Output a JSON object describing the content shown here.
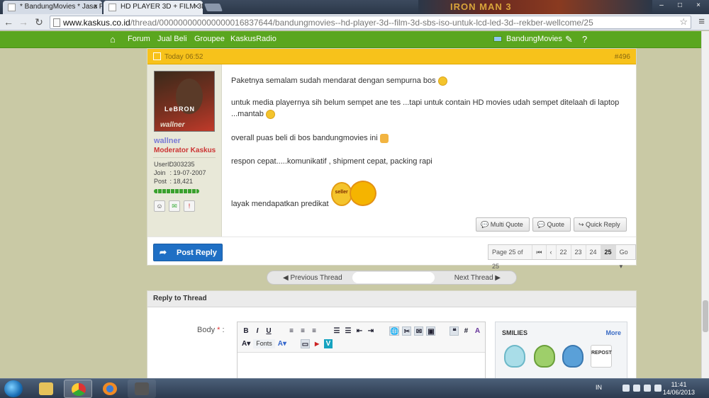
{
  "browser": {
    "tabs": [
      {
        "label": "* BandungMovies * Jasa P",
        "close": "×"
      },
      {
        "label": "HD PLAYER 3D + FILM 3D",
        "close": "×"
      }
    ],
    "banner_text": "IRON MAN 3",
    "window_buttons": [
      "–",
      "□",
      "×"
    ],
    "url_domain": "www.kaskus.co.id",
    "url_path": "/thread/000000000000000016837644/bandungmovies--hd-player-3d--film-3d-sbs-iso-untuk-lcd-led-3d--rekber-wellcome/25"
  },
  "site_nav": {
    "items": [
      "Forum",
      "Jual Beli",
      "Groupee",
      "KaskusRadio"
    ],
    "user": "BandungMovies"
  },
  "post": {
    "time": "Today 06:52",
    "number": "#496",
    "author": {
      "avatar_text": "LeBRON",
      "avatar_caption": "wallner",
      "name": "wallner",
      "role": "Moderator Kaskus",
      "stats": [
        {
          "key": "UserID",
          "value": ": 303235"
        },
        {
          "key": "Join",
          "value": ": 19-07-2007"
        },
        {
          "key": "Post",
          "value": ": 18,421"
        }
      ]
    },
    "lines": [
      "Paketnya semalam sudah mendarat dengan sempurna bos",
      "untuk media playernya sih belum sempet ane tes ...tapi untuk contain HD movies udah sempet ditelaah di laptop",
      "...mantab",
      "overall puas beli di bos bandungmovies ini",
      "respon cepat.....komunikatif , shipment cepat, packing rapi",
      "layak mendapatkan predikat"
    ],
    "seller_badge": "seller",
    "buttons": [
      "Multi Quote",
      "Quote",
      "Quick Reply"
    ]
  },
  "footer": {
    "post_reply": "Post Reply",
    "pager": {
      "page_info": "Page 25 of 25",
      "first": "⏮",
      "prev": "‹",
      "pages": [
        "22",
        "23",
        "24",
        "25"
      ],
      "current": "25",
      "go": "Go ▾"
    }
  },
  "thread_nav": {
    "previous": "Previous Thread",
    "next": "Next Thread"
  },
  "reply": {
    "title": "Reply to Thread",
    "body_label": "Body",
    "fonts_label": "Fonts",
    "smilies_title": "SMILIES",
    "smilies_more": "More",
    "repost_label": "REPOST"
  },
  "taskbar": {
    "lang": "IN",
    "time": "11:41",
    "date": "14/06/2013"
  }
}
